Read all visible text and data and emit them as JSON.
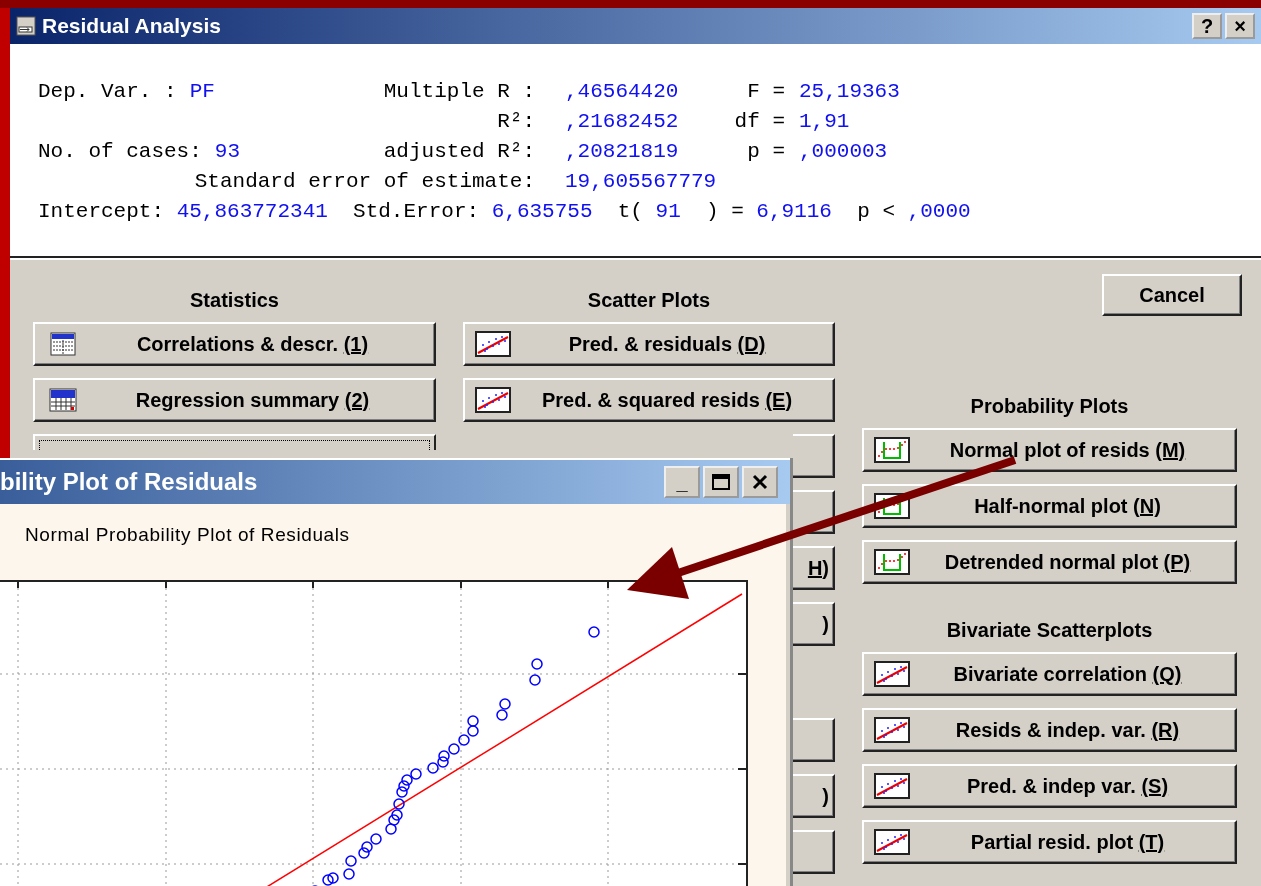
{
  "window": {
    "title": "Residual Analysis",
    "help_button": "?",
    "close_button": "×"
  },
  "output": {
    "rows": [
      {
        "left_label": "Dep. Var. :",
        "left_value": "PF",
        "mid_label": "Multiple R :",
        "mid_value": ",46564420",
        "right_label": "F =",
        "right_value": "25,19363"
      },
      {
        "mid_label": "R²:",
        "mid_value": ",21682452",
        "right_label": "df =",
        "right_value": "1,91"
      },
      {
        "left_label": "No. of cases:",
        "left_value": "93",
        "mid_label": "adjusted R²:",
        "mid_value": ",20821819",
        "right_label": "p =",
        "right_value": ",000003"
      },
      {
        "wide_label": "Standard error of estimate:",
        "mid_value": "19,605567779"
      }
    ],
    "intercept_line": [
      {
        "text": "Intercept:",
        "kind": "label"
      },
      {
        "text": "45,863772341",
        "kind": "value"
      },
      {
        "text": "Std.Error:",
        "kind": "label"
      },
      {
        "text": "6,635755",
        "kind": "value"
      },
      {
        "text": "t(",
        "kind": "label"
      },
      {
        "text": "91",
        "kind": "value"
      },
      {
        "text": ") =",
        "kind": "label"
      },
      {
        "text": "6,9116",
        "kind": "value"
      },
      {
        "text": "p <",
        "kind": "label"
      },
      {
        "text": ",0000",
        "kind": "value"
      }
    ]
  },
  "panel": {
    "columns": [
      {
        "sections": [
          {
            "title": "Statistics",
            "buttons": [
              {
                "text": "Correlations & descr. ",
                "key": "(1)",
                "kind": "table",
                "focused": false
              },
              {
                "text": "Regression summary ",
                "key": "(2)",
                "kind": "summary",
                "focused": false
              },
              {
                "kind": "sliver",
                "focused": true
              }
            ]
          }
        ]
      },
      {
        "sections": [
          {
            "title": "Scatter Plots",
            "buttons": [
              {
                "text": "Pred. & residuals ",
                "key": "(D)",
                "kind": "scatter"
              },
              {
                "text": "Pred. & squared resids ",
                "key": "(E)",
                "kind": "scatter"
              },
              {
                "kind": "stub"
              },
              {
                "kind": "stub"
              },
              {
                "key": "H)",
                "kind": "stub"
              },
              {
                "key": ")",
                "kind": "stub"
              }
            ]
          },
          {
            "buttons": [
              {
                "kind": "stub"
              },
              {
                "key": ")",
                "kind": "stub"
              },
              {
                "kind": "stub"
              }
            ]
          }
        ]
      },
      {
        "cancel_button": "Cancel",
        "sections": [
          {
            "title": "Probability Plots",
            "buttons": [
              {
                "text": "Normal plot of resids ",
                "key": "(M)",
                "kind": "probability"
              },
              {
                "text": "Half-normal plot ",
                "key": "(N)",
                "kind": "probability"
              },
              {
                "text": "Detrended normal plot ",
                "key": "(P)",
                "kind": "probability"
              }
            ]
          },
          {
            "title": "Bivariate Scatterplots",
            "buttons": [
              {
                "text": "Bivariate correlation ",
                "key": "(Q)",
                "kind": "scatter"
              },
              {
                "text": "Resids & indep. var. ",
                "key": "(R)",
                "kind": "scatter"
              },
              {
                "text": "Pred. & indep var. ",
                "key": "(S)",
                "kind": "scatter"
              },
              {
                "text": "Partial resid. plot ",
                "key": "(T)",
                "kind": "scatter"
              }
            ]
          }
        ]
      }
    ]
  },
  "plot_window": {
    "title": "bility Plot of Residuals",
    "minimize_button": "_",
    "caption": "Normal Probability Plot of Residuals"
  }
}
